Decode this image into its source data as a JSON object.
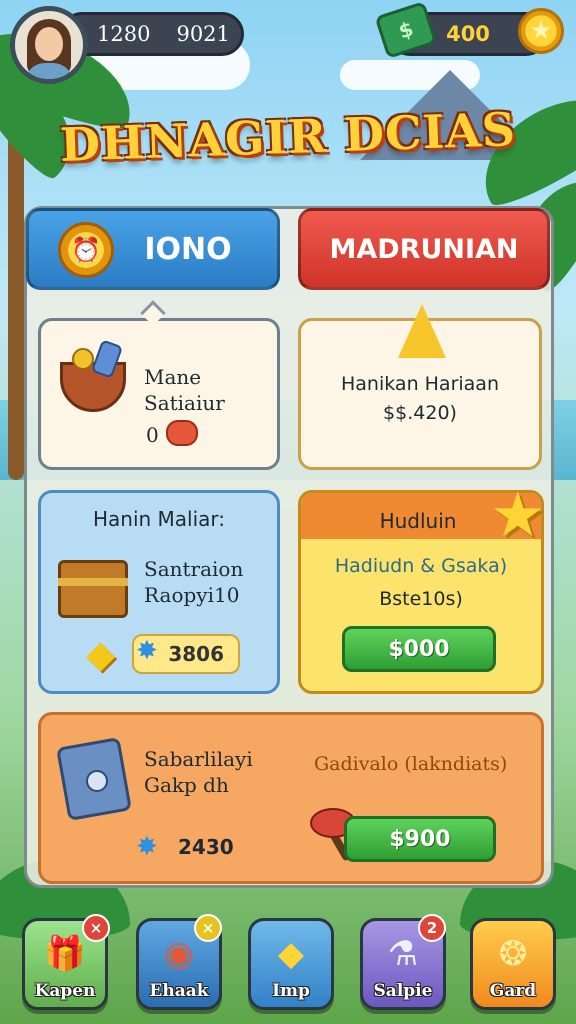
{
  "top_bar": {
    "resource_1": "1280",
    "resource_2": "9021",
    "coins": "400"
  },
  "title": "DHNAGIR DCIAS",
  "tabs": [
    {
      "label": "IONO"
    },
    {
      "label": "MADRUNIAN"
    }
  ],
  "cards": {
    "basket": {
      "line1": "Mane",
      "line2": "Satiaiur",
      "value": "0"
    },
    "cone": {
      "line1": "Hanikan Hariaan",
      "line2": "$$.420)"
    },
    "chest": {
      "title": "Hanin Maliar:",
      "line1": "Santraion",
      "line2": "Raopyi10",
      "price": "3806"
    },
    "star": {
      "header": "Hudluin",
      "line1": "Hadiudn & Gsaka)",
      "line2": "Bste10s)",
      "button": "$000"
    },
    "safe": {
      "line1": "Sabarlilayi",
      "line2": "Gakp dh",
      "price": "2430",
      "right_title": "Gadivalo (lakndiats)",
      "button": "$900"
    }
  },
  "nav": [
    {
      "label": "Kapen",
      "icon": "gift-icon",
      "badge": "×",
      "badge_color": "#e0453a"
    },
    {
      "label": "Ehaak",
      "icon": "horseshoe-icon",
      "badge": "×",
      "badge_color": "#e8c21f"
    },
    {
      "label": "Imp",
      "icon": "gem-icon",
      "badge": "",
      "badge_color": ""
    },
    {
      "label": "Salpie",
      "icon": "potion-icon",
      "badge": "2",
      "badge_color": "#e0453a"
    },
    {
      "label": "Gard",
      "icon": "creature-icon",
      "badge": "",
      "badge_color": ""
    }
  ],
  "colors": {
    "accent_blue": "#2b7cc4",
    "accent_red": "#cf3327",
    "accent_green": "#2f9e34",
    "accent_gold": "#ffd23a"
  }
}
